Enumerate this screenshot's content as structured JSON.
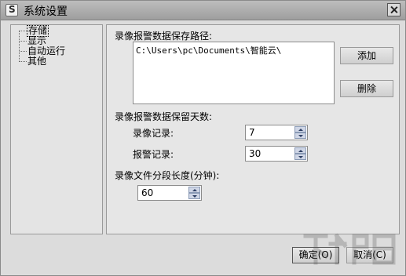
{
  "window": {
    "title": "系统设置"
  },
  "tree": {
    "items": [
      "存储",
      "显示",
      "自动运行",
      "其他"
    ],
    "selected": "存储"
  },
  "storage": {
    "path_label": "录像报警数据保存路径:",
    "path_value": "C:\\Users\\pc\\Documents\\智能云\\",
    "add_button": "添加",
    "delete_button": "删除",
    "retention_label": "录像报警数据保留天数:",
    "record_label": "录像记录:",
    "record_value": "7",
    "alarm_label": "报警记录:",
    "alarm_value": "30",
    "segment_label": "录像文件分段长度(分钟):",
    "segment_value": "60"
  },
  "footer": {
    "ok_button": "确定(O)",
    "cancel_button": "取消(C)"
  }
}
